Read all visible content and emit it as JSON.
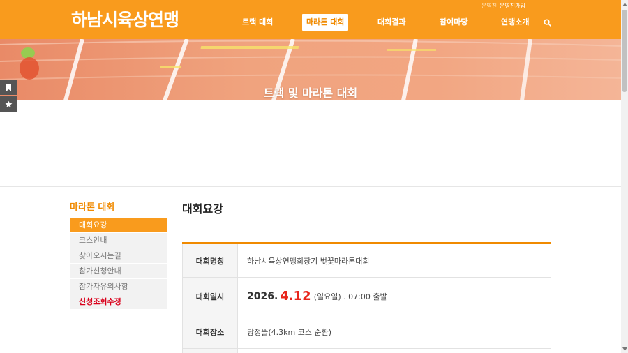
{
  "header": {
    "logo": "하남시육상연맹",
    "util_links": [
      "운영진",
      "운영진가입"
    ],
    "nav": [
      "트랙 대회",
      "마라톤 대회",
      "대회결과",
      "참여마당",
      "연맹소개"
    ],
    "active_nav": "마라톤 대회"
  },
  "banner": {
    "title": "트랙 및 마라톤 대회"
  },
  "lnb": {
    "title": "마라톤 대회",
    "items": [
      "대회요강",
      "코스안내",
      "찾아오시는길",
      "참가신청안내",
      "참가자유의사항",
      "신청조회수정"
    ],
    "active_item": "대회요강"
  },
  "content": {
    "title": "대회요강",
    "rows": [
      {
        "label": "대회명칭",
        "value": "하남시육상연맹회장기 벚꽃마라톤대회"
      },
      {
        "label": "대회일시",
        "year": "2026.",
        "month_day": "4.12",
        "rest": "(일요일) . 07:00 출발"
      },
      {
        "label": "대회장소",
        "value": "당정뜰(4.3km 코스 순환)"
      }
    ]
  },
  "colors": {
    "brand_orange": "#f99b1d",
    "accent_red": "#e8251b",
    "menu_red": "#d9001b"
  }
}
